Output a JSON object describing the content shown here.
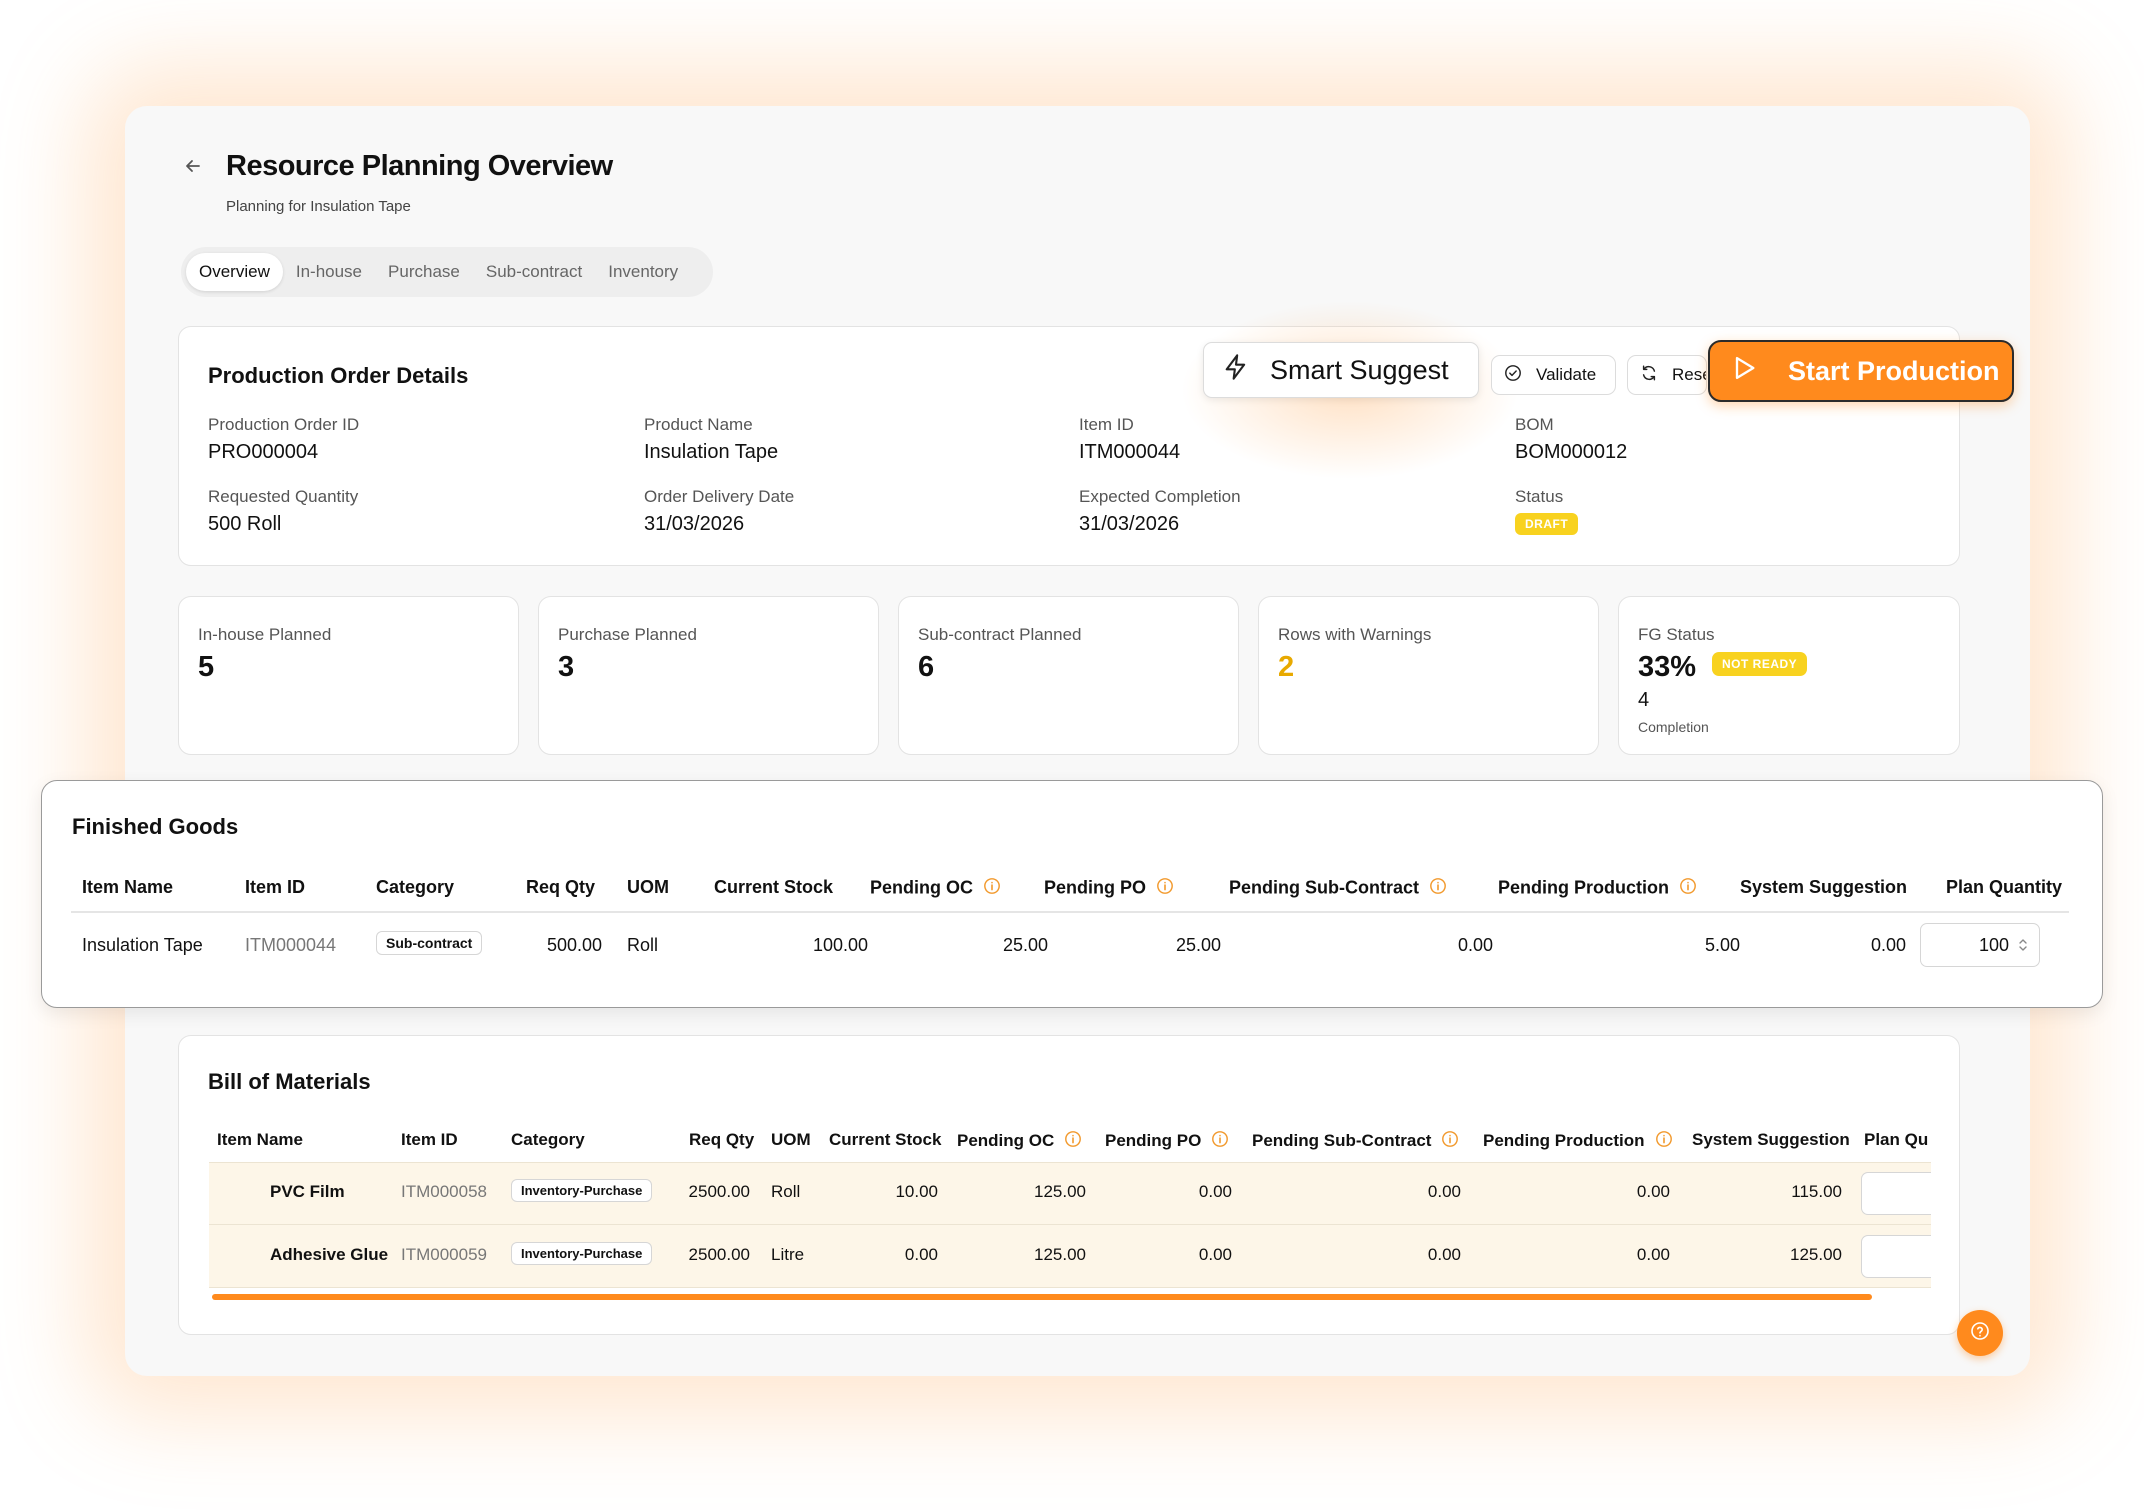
{
  "header": {
    "title": "Resource Planning Overview",
    "subtitle": "Planning for Insulation Tape"
  },
  "tabs": [
    {
      "label": "Overview",
      "active": true
    },
    {
      "label": "In-house",
      "active": false
    },
    {
      "label": "Purchase",
      "active": false
    },
    {
      "label": "Sub-contract",
      "active": false
    },
    {
      "label": "Inventory",
      "active": false
    }
  ],
  "order": {
    "title": "Production Order Details",
    "fields": [
      {
        "label": "Production Order ID",
        "value": "PRO000004"
      },
      {
        "label": "Product Name",
        "value": "Insulation Tape"
      },
      {
        "label": "Item ID",
        "value": "ITM000044"
      },
      {
        "label": "BOM",
        "value": "BOM000012"
      },
      {
        "label": "Requested Quantity",
        "value": "500 Roll"
      },
      {
        "label": "Order Delivery Date",
        "value": "31/03/2026"
      },
      {
        "label": "Expected Completion",
        "value": "31/03/2026"
      },
      {
        "label": "Status",
        "value": "DRAFT"
      }
    ]
  },
  "actions": {
    "smart_suggest": "Smart Suggest",
    "validate": "Validate",
    "reset": "Reset",
    "start_production": "Start Production"
  },
  "stats": [
    {
      "label": "In-house Planned",
      "value": "5"
    },
    {
      "label": "Purchase Planned",
      "value": "3"
    },
    {
      "label": "Sub-contract Planned",
      "value": "6"
    },
    {
      "label": "Rows with Warnings",
      "value": "2"
    },
    {
      "label": "FG Status",
      "value": "33%",
      "badge": "NOT READY",
      "sub_value": "4",
      "sub_label": "Completion"
    }
  ],
  "finished_goods": {
    "title": "Finished Goods",
    "columns": [
      "Item Name",
      "Item ID",
      "Category",
      "Req Qty",
      "UOM",
      "Current Stock",
      "Pending OC",
      "Pending PO",
      "Pending Sub-Contract",
      "Pending Production",
      "System Suggestion",
      "Plan Quantity"
    ],
    "rows": [
      {
        "item_name": "Insulation Tape",
        "item_id": "ITM000044",
        "category": "Sub-contract",
        "req_qty": "500.00",
        "uom": "Roll",
        "current_stock": "100.00",
        "pending_oc": "25.00",
        "pending_po": "25.00",
        "pending_sub": "0.00",
        "pending_prod": "5.00",
        "suggestion": "0.00",
        "plan_qty": "100"
      }
    ]
  },
  "bom": {
    "title": "Bill of Materials",
    "columns": [
      "Item Name",
      "Item ID",
      "Category",
      "Req Qty",
      "UOM",
      "Current Stock",
      "Pending OC",
      "Pending PO",
      "Pending Sub-Contract",
      "Pending Production",
      "System Suggestion",
      "Plan Qu"
    ],
    "rows": [
      {
        "item_name": "PVC Film",
        "item_id": "ITM000058",
        "category": "Inventory-Purchase",
        "req_qty": "2500.00",
        "uom": "Roll",
        "current_stock": "10.00",
        "pending_oc": "125.00",
        "pending_po": "0.00",
        "pending_sub": "0.00",
        "pending_prod": "0.00",
        "suggestion": "115.00"
      },
      {
        "item_name": "Adhesive Glue",
        "item_id": "ITM000059",
        "category": "Inventory-Purchase",
        "req_qty": "2500.00",
        "uom": "Litre",
        "current_stock": "0.00",
        "pending_oc": "125.00",
        "pending_po": "0.00",
        "pending_sub": "0.00",
        "pending_prod": "0.00",
        "suggestion": "125.00"
      }
    ]
  },
  "icons": {
    "back": "arrow-left-icon",
    "smart": "lightning-icon",
    "validate": "check-circle-icon",
    "reset": "refresh-icon",
    "start": "play-icon",
    "info": "info-icon",
    "help": "help-circle-icon"
  },
  "colors": {
    "accent": "#ff8a1d",
    "warning": "#e8a900",
    "badge_yellow": "#f8d21f",
    "info_icon": "#f29a2e",
    "bom_row_bg": "#fdf6e8"
  }
}
